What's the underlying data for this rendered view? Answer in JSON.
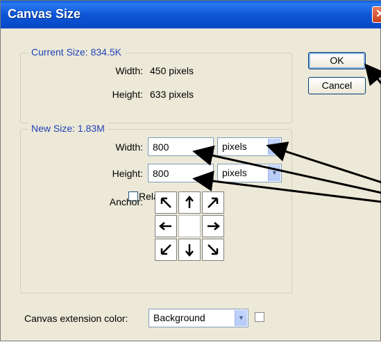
{
  "window": {
    "title": "Canvas Size",
    "close_glyph": "✕"
  },
  "current_size": {
    "caption": "Current Size: 834.5K",
    "width_label": "Width:",
    "width_value": "450 pixels",
    "height_label": "Height:",
    "height_value": "633 pixels"
  },
  "new_size": {
    "caption": "New Size: 1.83M",
    "width_label": "Width:",
    "width_value": "800",
    "width_unit": "pixels",
    "height_label": "Height:",
    "height_value": "800",
    "height_unit": "pixels",
    "relative_label": "Relative",
    "relative_checked": false,
    "anchor_label": "Anchor:",
    "anchor_arrows": [
      "arrow-up-left-icon",
      "arrow-up-icon",
      "arrow-up-right-icon",
      "arrow-left-icon",
      "anchor-center",
      "arrow-right-icon",
      "arrow-down-left-icon",
      "arrow-down-icon",
      "arrow-down-right-icon"
    ]
  },
  "buttons": {
    "ok": "OK",
    "cancel": "Cancel"
  },
  "extension": {
    "label": "Canvas extension color:",
    "value": "Background",
    "swatch_color": "#ffffff"
  },
  "colors": {
    "title_bar": "#0a5fd8",
    "dialog_bg": "#ece9d8",
    "caption_text": "#1f3fb8",
    "close_button": "#c6401d"
  }
}
